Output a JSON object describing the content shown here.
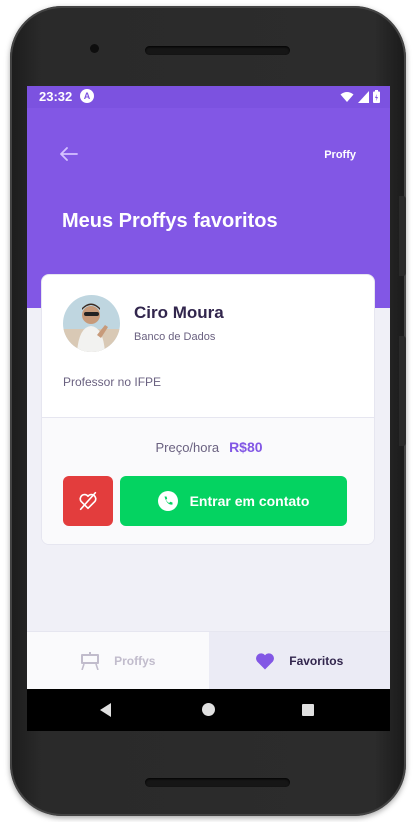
{
  "status": {
    "time": "23:32",
    "app_badge": "A"
  },
  "header": {
    "logo": "Proffy",
    "title": "Meus Proffys favoritos"
  },
  "teacher": {
    "name": "Ciro Moura",
    "subject": "Banco de Dados",
    "bio": "Professor no IFPE",
    "price_label": "Preço/hora",
    "price_value": "R$80",
    "contact_label": "Entrar em contato"
  },
  "tabs": [
    {
      "label": "Proffys",
      "icon": "easel-icon",
      "active": false
    },
    {
      "label": "Favoritos",
      "icon": "heart-icon",
      "active": true
    }
  ],
  "colors": {
    "primary": "#8257e5",
    "danger": "#e33d3d",
    "success": "#04d361",
    "text_title": "#32264d"
  }
}
